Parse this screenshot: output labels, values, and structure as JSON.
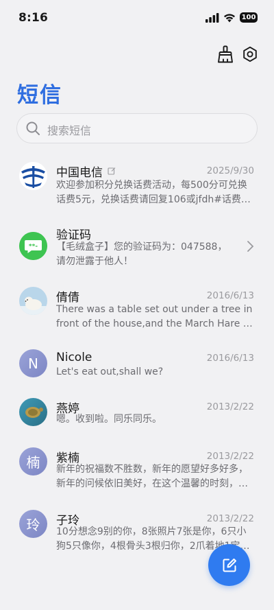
{
  "status_bar": {
    "time": "8:16",
    "battery": "100"
  },
  "page_title": "短信",
  "search": {
    "placeholder": "搜索短信"
  },
  "messages": [
    {
      "name": "中国电信",
      "date": "2025/9/30",
      "preview_lines": [
        "欢迎参加积分兑换话费活动，每500分可兑换",
        "话费5元，兑换话费请回复106或jfdh#话费…"
      ],
      "avatar": "china-telecom-logo"
    },
    {
      "name": "验证码",
      "date": "",
      "preview_lines": [
        "【毛绒盒子】您的验证码为：047588，",
        "请勿泄露于他人！"
      ],
      "avatar": "verification-code-icon"
    },
    {
      "name": "倩倩",
      "date": "2016/6/13",
      "preview_lines": [
        "There was a table set out under a tree in",
        "front of the house,and the March Hare an…"
      ],
      "avatar": "polar-bear-photo"
    },
    {
      "name": "Nicole",
      "date": "2016/6/13",
      "preview_lines": [
        "Let's eat out,shall we?"
      ],
      "avatar_letter": "N"
    },
    {
      "name": "燕婷",
      "date": "2013/2/22",
      "preview_lines": [
        "嗯。收到啦。同乐同乐。"
      ],
      "avatar": "turtle-photo"
    },
    {
      "name": "紫楠",
      "date": "2013/2/22",
      "preview_lines": [
        "新年的祝福数不胜数，新年的愿望好多好多，",
        "新年的问候依旧美好，在这个温馨的时刻，…"
      ],
      "avatar_letter": "楠"
    },
    {
      "name": "子玲",
      "date": "2013/2/22",
      "preview_lines": [
        "10分想念9别的你，8张照片7张是你，6只小",
        "狗5只像你，4根骨头3根归你，2爪着地1宝…"
      ],
      "avatar_letter": "玲"
    }
  ],
  "colors": {
    "accent": "#2f6ee0",
    "fab": "#2f7bf0",
    "telecom": "#1a4ea3",
    "verify_green": "#3ec451"
  }
}
